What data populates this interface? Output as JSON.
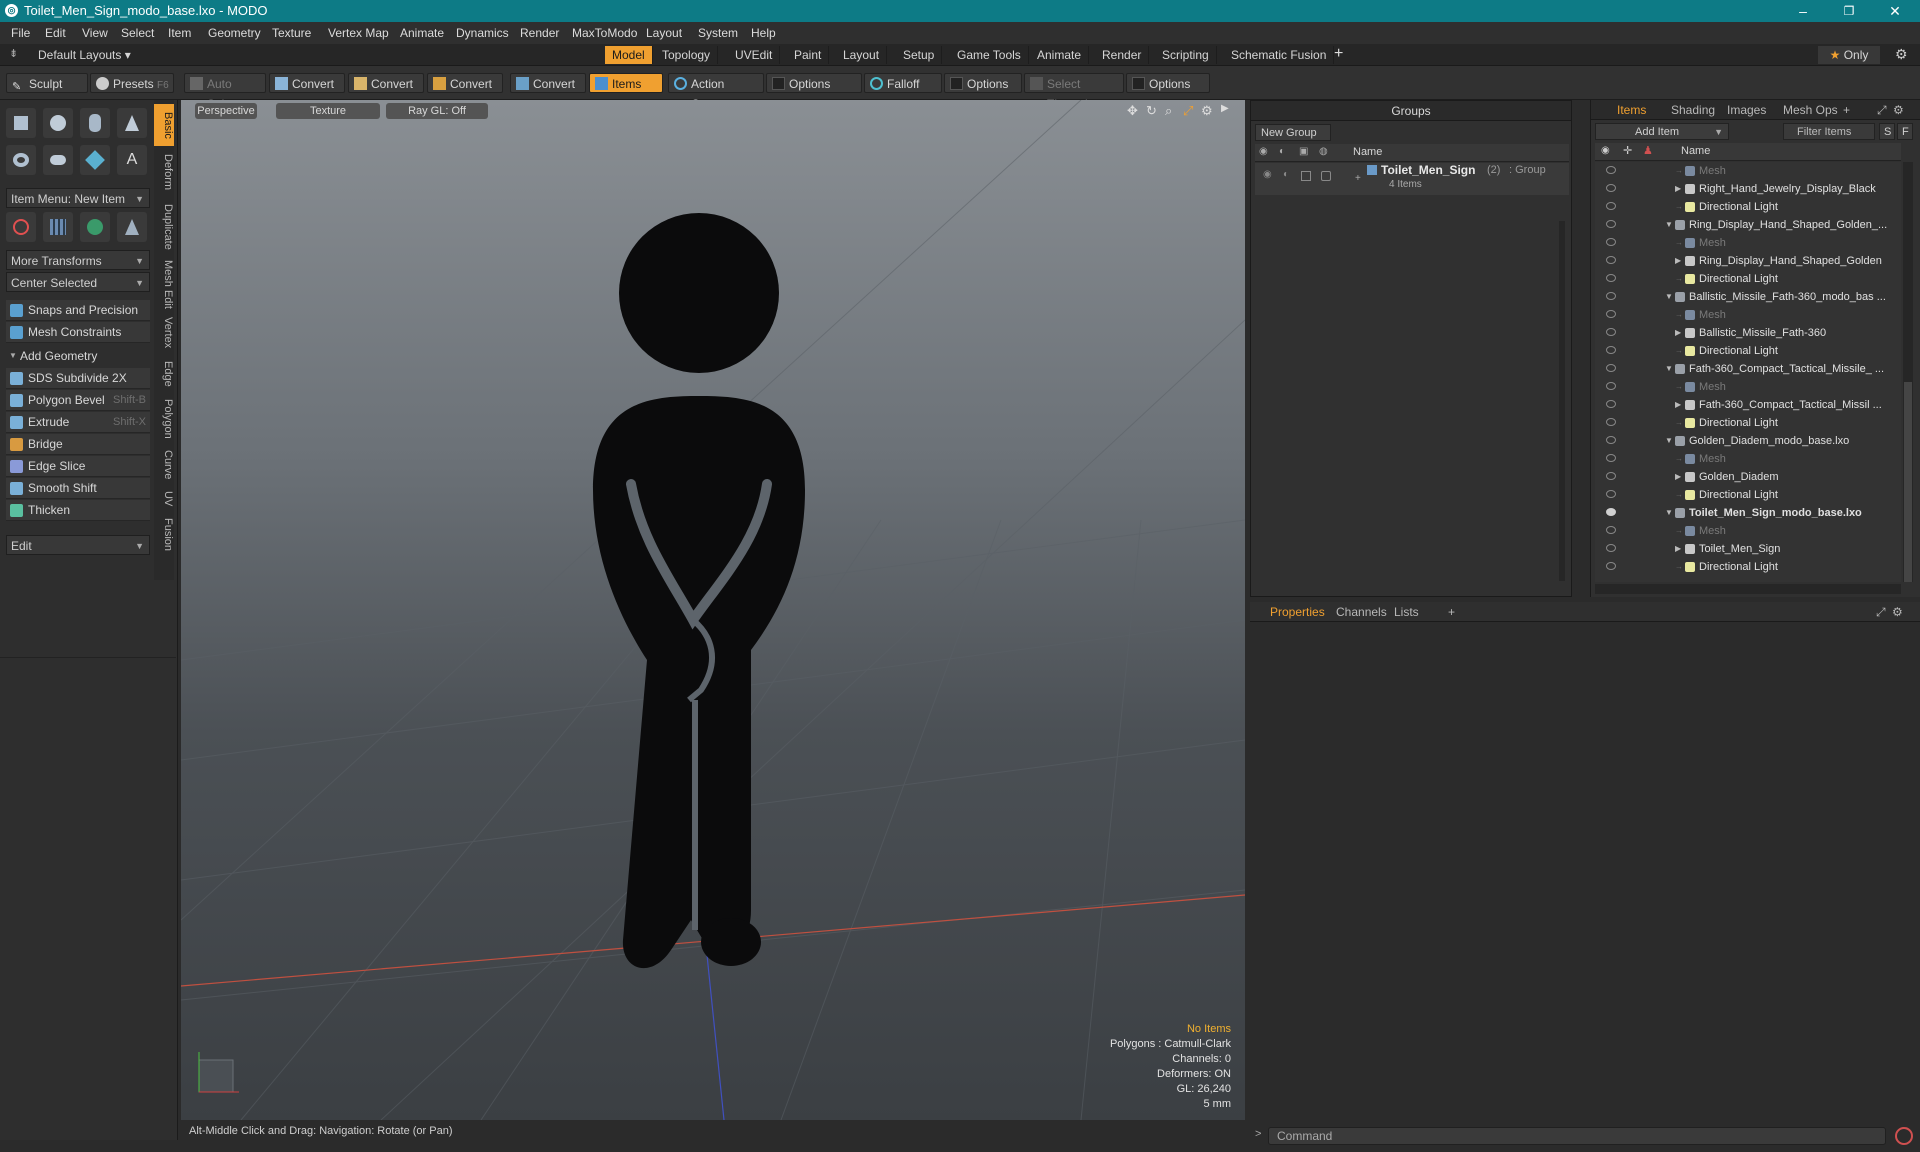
{
  "window": {
    "title": "Toilet_Men_Sign_modo_base.lxo - MODO",
    "minimize": "–",
    "maximize": "❐",
    "close": "✕"
  },
  "menu": [
    "File",
    "Edit",
    "View",
    "Select",
    "Item",
    "Geometry",
    "Texture",
    "Vertex Map",
    "Animate",
    "Dynamics",
    "Render",
    "MaxToModo",
    "Layout",
    "System",
    "Help"
  ],
  "layoutbar": {
    "layouts": "Default Layouts",
    "tabs": [
      "Model",
      "Topology",
      "UVEdit",
      "Paint",
      "Layout",
      "Setup",
      "Game Tools",
      "Animate",
      "Render",
      "Scripting",
      "Schematic Fusion"
    ],
    "active_tab": "Model",
    "add": "+",
    "only": "Only"
  },
  "toolbar": {
    "sculpt": "Sculpt",
    "presets": "Presets",
    "presets_shortcut": "F6",
    "auto_select": "Auto Select",
    "convert1": "Convert",
    "convert2": "Convert",
    "convert3": "Convert",
    "convert4": "Convert",
    "items": "Items",
    "action_center": "Action Center",
    "options1": "Options",
    "falloff": "Falloff",
    "options2": "Options",
    "select_through": "Select Through",
    "options3": "Options"
  },
  "left": {
    "item_menu": "Item Menu: New Item",
    "more_transforms": "More Transforms",
    "center_selected": "Center Selected",
    "snaps": "Snaps and Precision",
    "mesh_constraints": "Mesh Constraints",
    "add_geometry": "Add Geometry",
    "tools": [
      {
        "label": "SDS Subdivide 2X",
        "shortcut": ""
      },
      {
        "label": "Polygon Bevel",
        "shortcut": "Shift-B"
      },
      {
        "label": "Extrude",
        "shortcut": "Shift-X"
      },
      {
        "label": "Bridge",
        "shortcut": ""
      },
      {
        "label": "Edge Slice",
        "shortcut": ""
      },
      {
        "label": "Smooth Shift",
        "shortcut": ""
      },
      {
        "label": "Thicken",
        "shortcut": ""
      }
    ],
    "edit": "Edit",
    "vtabs": [
      "Basic",
      "Deform",
      "Duplicate",
      "Mesh Edit",
      "Vertex",
      "Edge",
      "Polygon",
      "Curve",
      "UV",
      "Fusion"
    ]
  },
  "viewport": {
    "view": "Perspective",
    "shading": "Texture",
    "raygl": "Ray GL: Off",
    "info": {
      "selection": "No Items",
      "polygons": "Polygons : Catmull-Clark",
      "channels": "Channels: 0",
      "deformers": "Deformers: ON",
      "gl": "GL: 26,240",
      "scale": "5 mm"
    }
  },
  "status": "Alt-Middle Click and Drag:   Navigation: Rotate (or Pan)",
  "groups": {
    "title": "Groups",
    "new_group": "New Group",
    "name_header": "Name",
    "group_name": "Toilet_Men_Sign",
    "group_count": "(2)",
    "group_type": ": Group",
    "group_items": "4 Items"
  },
  "items_panel": {
    "tabs": [
      "Items",
      "Shading",
      "Images",
      "Mesh Ops"
    ],
    "add_item": "Add Item",
    "filter": "Filter Items",
    "s": "S",
    "f": "F",
    "name_header": "Name",
    "rows": [
      {
        "label": "Mesh",
        "indent": 2,
        "kind": "mesh",
        "dim": true,
        "tri": ""
      },
      {
        "label": "Right_Hand_Jewelry_Display_Black",
        "indent": 2,
        "kind": "item",
        "dim": false,
        "tri": "▶"
      },
      {
        "label": "Directional Light",
        "indent": 2,
        "kind": "light",
        "dim": false,
        "tri": ""
      },
      {
        "label": "Ring_Display_Hand_Shaped_Golden_...",
        "indent": 1,
        "kind": "scene",
        "dim": false,
        "tri": "▼"
      },
      {
        "label": "Mesh",
        "indent": 2,
        "kind": "mesh",
        "dim": true,
        "tri": ""
      },
      {
        "label": "Ring_Display_Hand_Shaped_Golden",
        "indent": 2,
        "kind": "item",
        "dim": false,
        "tri": "▶"
      },
      {
        "label": "Directional Light",
        "indent": 2,
        "kind": "light",
        "dim": false,
        "tri": ""
      },
      {
        "label": "Ballistic_Missile_Fath-360_modo_bas ...",
        "indent": 1,
        "kind": "scene",
        "dim": false,
        "tri": "▼"
      },
      {
        "label": "Mesh",
        "indent": 2,
        "kind": "mesh",
        "dim": true,
        "tri": ""
      },
      {
        "label": "Ballistic_Missile_Fath-360",
        "indent": 2,
        "kind": "item",
        "dim": false,
        "tri": "▶"
      },
      {
        "label": "Directional Light",
        "indent": 2,
        "kind": "light",
        "dim": false,
        "tri": ""
      },
      {
        "label": "Fath-360_Compact_Tactical_Missile_ ...",
        "indent": 1,
        "kind": "scene",
        "dim": false,
        "tri": "▼"
      },
      {
        "label": "Mesh",
        "indent": 2,
        "kind": "mesh",
        "dim": true,
        "tri": ""
      },
      {
        "label": "Fath-360_Compact_Tactical_Missil ...",
        "indent": 2,
        "kind": "item",
        "dim": false,
        "tri": "▶"
      },
      {
        "label": "Directional Light",
        "indent": 2,
        "kind": "light",
        "dim": false,
        "tri": ""
      },
      {
        "label": "Golden_Diadem_modo_base.lxo",
        "indent": 1,
        "kind": "scene",
        "dim": false,
        "tri": "▼"
      },
      {
        "label": "Mesh",
        "indent": 2,
        "kind": "mesh",
        "dim": true,
        "tri": ""
      },
      {
        "label": "Golden_Diadem",
        "indent": 2,
        "kind": "item",
        "dim": false,
        "tri": "▶"
      },
      {
        "label": "Directional Light",
        "indent": 2,
        "kind": "light",
        "dim": false,
        "tri": ""
      },
      {
        "label": "Toilet_Men_Sign_modo_base.lxo",
        "indent": 1,
        "kind": "scene",
        "dim": false,
        "tri": "▼",
        "bold": true
      },
      {
        "label": "Mesh",
        "indent": 2,
        "kind": "mesh",
        "dim": true,
        "tri": ""
      },
      {
        "label": "Toilet_Men_Sign",
        "indent": 2,
        "kind": "item",
        "dim": false,
        "tri": "▶"
      },
      {
        "label": "Directional Light",
        "indent": 2,
        "kind": "light",
        "dim": false,
        "tri": ""
      }
    ]
  },
  "props": {
    "tabs": [
      "Properties",
      "Channels",
      "Lists"
    ],
    "add": "+",
    "command_placeholder": "Command"
  },
  "colors": {
    "accent": "#f0a030",
    "titlebar": "#0d7b86"
  }
}
